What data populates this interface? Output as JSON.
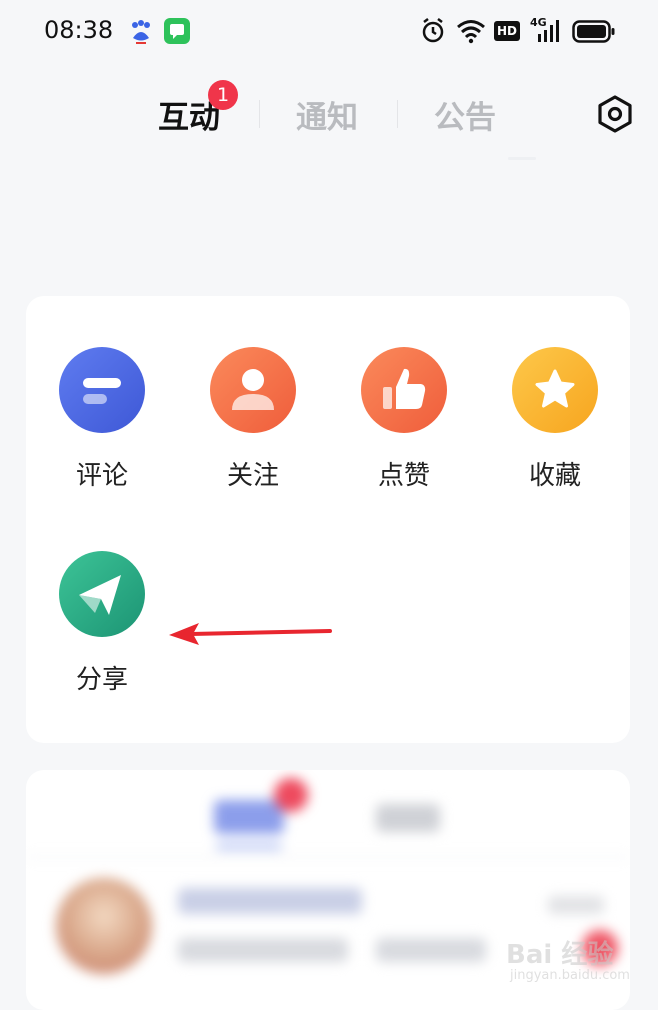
{
  "status_bar": {
    "time": "08:38",
    "hd_label": "HD",
    "network_label": "4G"
  },
  "tabs": [
    {
      "label": "互动",
      "active": true,
      "badge": "1"
    },
    {
      "label": "通知",
      "active": false
    },
    {
      "label": "公告",
      "active": false
    }
  ],
  "interaction_items": [
    {
      "label": "评论",
      "icon": "comment-icon",
      "color": "#4e6ae6"
    },
    {
      "label": "关注",
      "icon": "follow-icon",
      "color": "#f56a43"
    },
    {
      "label": "点赞",
      "icon": "like-icon",
      "color": "#f56a43"
    },
    {
      "label": "收藏",
      "icon": "star-icon",
      "color": "#f9b52b"
    },
    {
      "label": "分享",
      "icon": "share-icon",
      "color": "#23a583"
    }
  ],
  "annotation": {
    "arrow_color": "#e8262f"
  },
  "watermark": {
    "text": "Bai 经验",
    "url": "jingyan.baidu.com"
  }
}
